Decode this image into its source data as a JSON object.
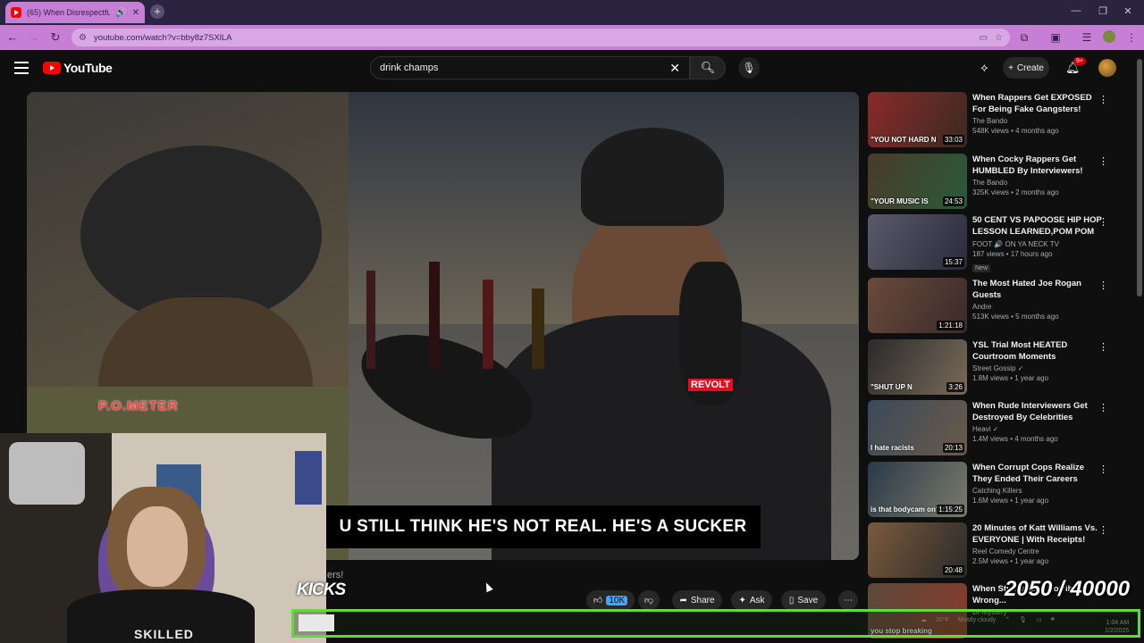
{
  "browser": {
    "tab_title": "(65) When Disrespectful Int",
    "url": "youtube.com/watch?v=bby8z7SXlLA",
    "accent_color": "#c77fd6"
  },
  "youtube": {
    "logo_text": "YouTube",
    "search_query": "drink champs",
    "create_label": "Create",
    "notifications": "9+"
  },
  "video": {
    "subtitle": "U STILL THINK HE'S NOT REAL. HE'S A SUCKER",
    "overlay_meter": "P.O.METER",
    "mic_flag": "REVOLT",
    "title_partial": "ers!",
    "like_count": "10K",
    "share_label": "Share",
    "ask_label": "Ask",
    "save_label": "Save"
  },
  "stream_overlay": {
    "kicks": "KICKS",
    "counter": "2050 / 40000",
    "shirt_text": "SKILLED"
  },
  "recommendations": [
    {
      "title": "When Rappers Get EXPOSED For Being Fake Gangsters!",
      "channel": "The Bando",
      "stats": "548K views • 4 months ago",
      "duration": "33:03",
      "thumb_text": "\"YOU NOT HARD N"
    },
    {
      "title": "When Cocky Rappers Get HUMBLED By Interviewers!",
      "channel": "The Bando",
      "stats": "325K views • 2 months ago",
      "duration": "24:53",
      "thumb_text": "\"YOUR MUSIC IS"
    },
    {
      "title": "50 CENT VS PAPOOSE HIP HOP LESSON LEARNED,POM POM ...",
      "channel": "FOOT 🔊 ON YA NECK TV",
      "stats": "187 views • 17 hours ago",
      "duration": "15:37",
      "badge": "New",
      "thumb_text": ""
    },
    {
      "title": "The Most Hated Joe Rogan Guests",
      "channel": "Andre",
      "stats": "513K views • 5 months ago",
      "duration": "1:21:18",
      "thumb_text": ""
    },
    {
      "title": "YSL Trial Most HEATED Courtroom Moments",
      "channel": "Street Gossip ✓",
      "stats": "1.8M views • 1 year ago",
      "duration": "3:26",
      "thumb_text": "\"SHUT UP N"
    },
    {
      "title": "When Rude Interviewers Get Destroyed By Celebrities",
      "channel": "Heavi ✓",
      "stats": "1.4M views • 4 months ago",
      "duration": "20:13",
      "thumb_text": "I hate racists"
    },
    {
      "title": "When Corrupt Cops Realize They Ended Their Careers",
      "channel": "Catching Killers",
      "stats": "1.6M views • 1 year ago",
      "duration": "1:15:25",
      "thumb_text": "is that bodycam on?"
    },
    {
      "title": "20 Minutes of Katt Williams Vs. EVERYONE | With Receipts!",
      "channel": "Reel Comedy Centre",
      "stats": "2.5M views • 1 year ago",
      "duration": "20:48",
      "thumb_text": ""
    },
    {
      "title": "When Stu... abs ... Horribly Wrong...",
      "channel": "Dr Mystery",
      "stats": "",
      "duration": "",
      "thumb_text": "you stop breaking"
    }
  ],
  "taskbar": {
    "weather": "20°F",
    "weather_sub": "Mostly cloudy",
    "time": "1:04 AM",
    "date": "1/2/2025"
  }
}
